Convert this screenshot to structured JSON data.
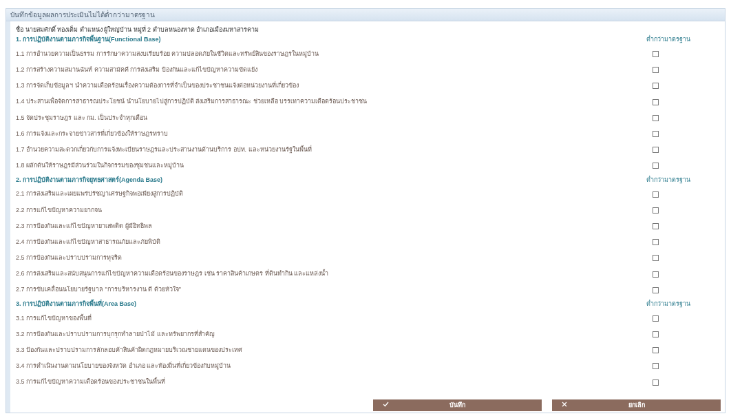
{
  "panel": {
    "title": "บันทึกข้อมูลผลการประเมินไม่ได้ต่ำกว่ามาตรฐาน"
  },
  "person_line": "ชื่อ นายสมศักดิ์ ทองเต็ม ตำแหน่ง ผู้ใหญ่บ้าน หมู่ที่ 2 ตำบลหนองหาด อำเภอเมืองมหาสารคาม",
  "sections": [
    {
      "title": "1. การปฏิบัติงานตามภารกิจพื้นฐาน(Functional Base)",
      "column_header": "ต่ำกว่ามาตรฐาน",
      "items": [
        {
          "text": "1.1 การอำนวยความเป็นธรรม การรักษาความสงบเรียบร้อย ความปลอดภัยในชีวิตและทรัพย์สินของราษฎรในหมู่บ้าน",
          "checked": false
        },
        {
          "text": "1.2 การสร้างความสมานฉันท์ ความสามัคคี การส่งเสริม ป้องกันและแก้ไขปัญหาความขัดแย้ง",
          "checked": false
        },
        {
          "text": "1.3 การจัดเก็บข้อมูลฯ นำความเดือดร้อนเรื่องความต้องการที่จำเป็นของประชาชนแจ้งต่อหน่วยงานที่เกี่ยวข้อง",
          "checked": false
        },
        {
          "text": "1.4 ประสานเพื่อจัดการสาธารณประโยชน์ นำนโยบายไปสู่การปฏิบัติ ส่งเสริมการสาธารณะ ช่วยเหลือ บรรเทาความเดือดร้อนประชาชน",
          "checked": false
        },
        {
          "text": "1.5 จัดประชุมราษฎร และ กม. เป็นประจำทุกเดือน",
          "checked": false
        },
        {
          "text": "1.6 การแจ้งและกระจายข่าวสารที่เกี่ยวข้องให้ราษฎรทราบ",
          "checked": false
        },
        {
          "text": "1.7 อำนวยความสะดวกเกี่ยวกับการแจ้งทะเบียนราษฎรและประสานงานด้านบริการ อปท. และหน่วยงานรัฐในพื้นที่",
          "checked": false
        },
        {
          "text": "1.8 ผลักดันให้ราษฎรมีส่วนร่วมในกิจกรรมของชุมชนและหมู่บ้าน",
          "checked": false
        }
      ]
    },
    {
      "title": "2. การปฏิบัติงานตามภารกิจยุทธศาสตร์(Agenda Base)",
      "column_header": "ต่ำกว่ามาตรฐาน",
      "items": [
        {
          "text": "2.1 การส่งเสริมและเผยแพร่ปรัชญาเศรษฐกิจพอเพียงสู่การปฏิบัติ",
          "checked": false
        },
        {
          "text": "2.2 การแก้ไขปัญหาความยากจน",
          "checked": false
        },
        {
          "text": "2.3 การป้องกันและแก้ไขปัญหายาเสพติด ผู้มีอิทธิพล",
          "checked": false
        },
        {
          "text": "2.4 การป้องกันและแก้ไขปัญหาสาธารณภัยและภัยพิบัติ",
          "checked": false
        },
        {
          "text": "2.5 การป้องกันและปราบปรามการทุจริต",
          "checked": false
        },
        {
          "text": "2.6 การส่งเสริมและสนับสนุนการแก้ไขปัญหาความเดือดร้อนของราษฎร เช่น ราคาสินค้าเกษตร ที่ดินทำกิน และแหล่งน้ำ",
          "checked": false
        },
        {
          "text": "2.7 การขับเคลื่อนนโยบายรัฐบาล \"การบริหารงาน ดี ด้วยหัวใจ\"",
          "checked": false
        }
      ]
    },
    {
      "title": "3. การปฏิบัติงานตามภารกิจพื้นที่(Area Base)",
      "column_header": "ต่ำกว่ามาตรฐาน",
      "items": [
        {
          "text": "3.1 การแก้ไขปัญหาของพื้นที่",
          "checked": false
        },
        {
          "text": "3.2 การป้องกันและปราบปรามการบุกรุกทำลายป่าไม้ และทรัพยากรที่สำคัญ",
          "checked": false
        },
        {
          "text": "3.3 ป้องกันและปราบปรามการลักลอบค้าสินค้าผิดกฎหมายบริเวณชายแดนของประเทศ",
          "checked": false
        },
        {
          "text": "3.4 การดำเนินงานตามนโยบายของจังหวัด อำเภอ และท้องถิ่นที่เกี่ยวข้องกับหมู่บ้าน",
          "checked": false
        },
        {
          "text": "3.5 การแก้ไขปัญหาความเดือดร้อนของประชาชนในพื้นที่",
          "checked": false
        }
      ]
    }
  ],
  "buttons": [
    {
      "kind": "save",
      "label": "บันทึก"
    },
    {
      "kind": "cancel",
      "label": "ยกเลิก"
    }
  ]
}
